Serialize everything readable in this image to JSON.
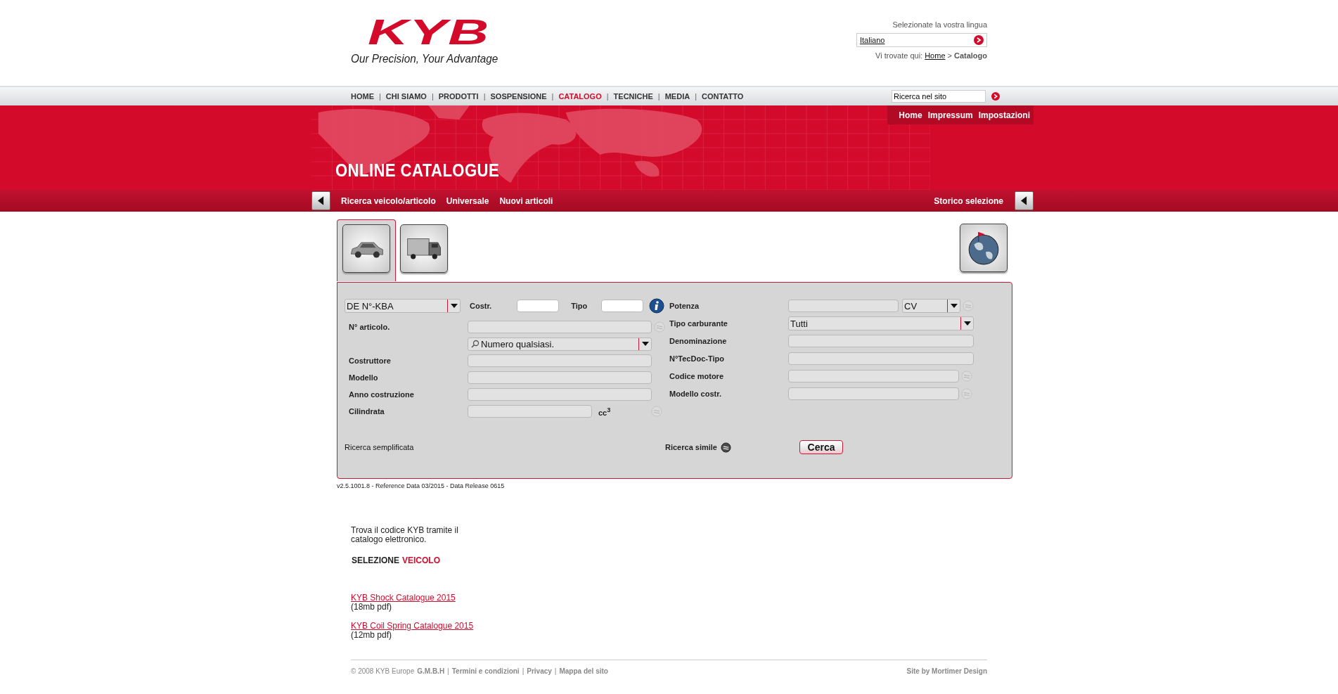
{
  "header": {
    "logo": "KYB",
    "tagline": "Our Precision, Your Advantage",
    "language_label": "Selezionate la vostra lingua",
    "language_value": "Italiano",
    "breadcrumb": {
      "prefix": "Vi trovate qui:",
      "link": "Home",
      "separator": ">",
      "current": "Catalogo"
    }
  },
  "nav": {
    "separator": "|",
    "items": [
      {
        "label": "HOME",
        "selected": false
      },
      {
        "label": "CHI SIAMO",
        "selected": false
      },
      {
        "label": "PRODOTTI",
        "selected": false
      },
      {
        "label": "SOSPENSIONE",
        "selected": false
      },
      {
        "label": "CATALOGO",
        "selected": true
      },
      {
        "label": "TECNICHE",
        "selected": false
      },
      {
        "label": "MEDIA",
        "selected": false
      },
      {
        "label": "CONTATTO",
        "selected": false
      }
    ]
  },
  "site_search": {
    "value": "Ricerca nel sito"
  },
  "utility_links": [
    "Home",
    "Impressum",
    "Impostazioni"
  ],
  "banner_title": "ONLINE CATALOGUE",
  "subnav": {
    "items": [
      "Ricerca veicolo/articolo",
      "Universale",
      "Nuovi articoli"
    ],
    "history": "Storico selezione"
  },
  "vehicle_tabs": [
    {
      "kind": "car",
      "selected": true
    },
    {
      "kind": "truck",
      "selected": false
    }
  ],
  "form": {
    "top": {
      "select": "DE N°-KBA",
      "fields": [
        "Costr.",
        "Tipo"
      ]
    },
    "left_rows": [
      {
        "kind": "text",
        "label": "N° articolo.",
        "similar": true
      },
      {
        "kind": "search_select",
        "value": "Numero qualsiasi.",
        "similar": false
      },
      {
        "kind": "text",
        "label": "Costruttore",
        "similar": false
      },
      {
        "kind": "text",
        "label": "Modello",
        "similar": false
      },
      {
        "kind": "text",
        "label": "Anno costruzione",
        "similar": false
      },
      {
        "kind": "unit",
        "label": "Cilindrata",
        "unit": "cc$^{3}$",
        "similar": true
      }
    ],
    "right_rows": [
      {
        "kind": "unit_select",
        "label": "Potenza",
        "value": "CV",
        "similar": true
      },
      {
        "kind": "select",
        "label": "Tipo carburante",
        "value": "Tutti",
        "similar": false
      },
      {
        "kind": "text",
        "label": "Denominazione",
        "similar": false
      },
      {
        "kind": "text",
        "label": "N°TecDoc-Tipo",
        "similar": false
      },
      {
        "kind": "short",
        "label": "Codice motore",
        "similar": true
      },
      {
        "kind": "short",
        "label": "Modello costr.",
        "similar": true
      }
    ],
    "simple_search": "Ricerca semplificata",
    "similar_search": "Ricerca simile",
    "search_button": "Cerca"
  },
  "version": "v2.5.1001.8 - Reference Data 03/2015 - Data Release 0615",
  "info": {
    "intro": "Trova il codice KYB tramite il catalogo elettronico.",
    "selection_label": "SELEZIONE",
    "selection_value": "VEICOLO",
    "downloads": [
      {
        "title": "KYB Shock Catalogue 2015",
        "size": "(18mb pdf)"
      },
      {
        "title": "KYB Coil Spring Catalogue 2015",
        "size": "(12mb pdf)"
      }
    ]
  },
  "footer": {
    "copyright": "© 2008 KYB Europe",
    "company": "G.M.B.H",
    "separator": "|",
    "links": [
      "Termini e condizioni",
      "Privacy",
      "Mappa del sito"
    ],
    "credit": "Site by Mortimer Design"
  }
}
